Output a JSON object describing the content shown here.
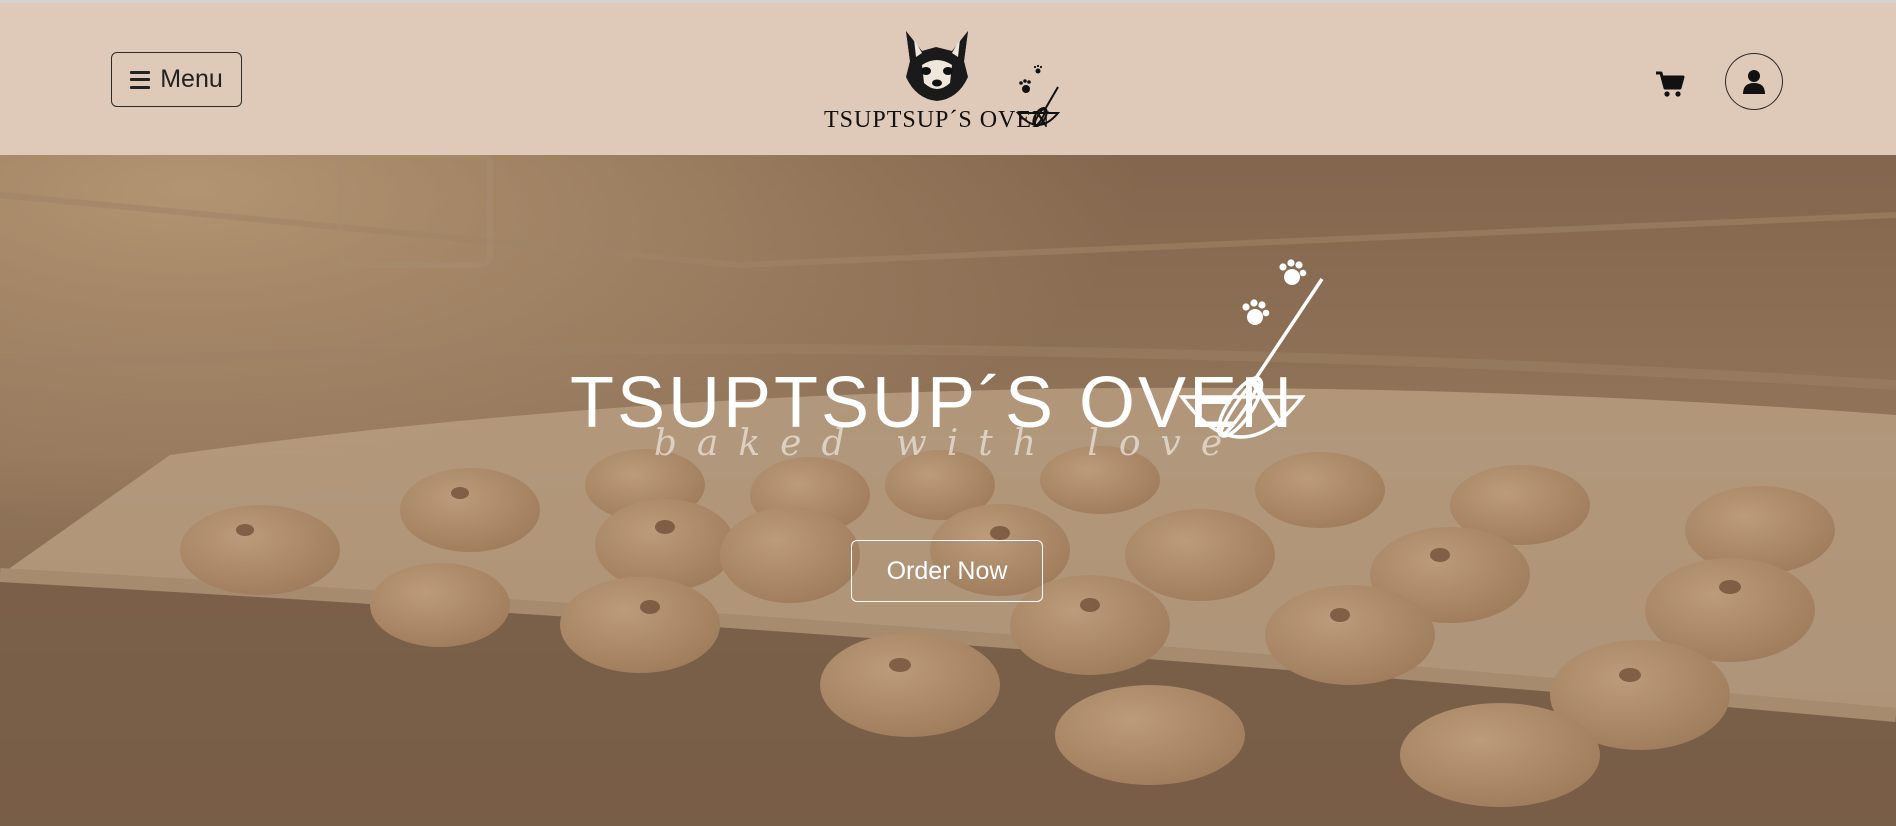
{
  "header": {
    "menu_label": "Menu",
    "brand_name": "TSUPTSUP´S OVEN",
    "icons": {
      "menu": "hamburger-icon",
      "cart": "cart-icon",
      "account": "user-icon"
    }
  },
  "hero": {
    "brand_name": "TSUPTSUP´S OVEN",
    "tagline": "baked with love",
    "cta_label": "Order Now"
  },
  "colors": {
    "header_background": "#dfc9b8",
    "hero_overlay": "#8e7156",
    "text_dark": "#222222",
    "text_light": "#ffffff"
  }
}
